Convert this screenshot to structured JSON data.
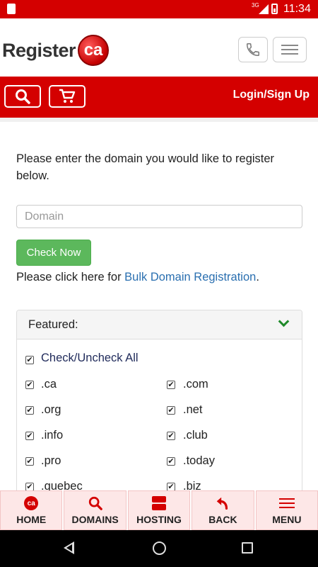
{
  "status_bar": {
    "time": "11:34",
    "network": "3G"
  },
  "header": {
    "logo_text": "Register",
    "logo_badge": "ca",
    "login_label": "Login/Sign Up"
  },
  "main": {
    "intro_text": "Please enter the domain you would like to register below.",
    "domain_placeholder": "Domain",
    "check_button": "Check Now",
    "bulk_prefix": "Please click here for ",
    "bulk_link": "Bulk Domain Registration",
    "bulk_suffix": "."
  },
  "featured": {
    "title": "Featured:",
    "check_all_label": "Check/Uncheck All",
    "tlds_left": [
      ".ca",
      ".org",
      ".info",
      ".pro",
      ".quebec"
    ],
    "tlds_right": [
      ".com",
      ".net",
      ".club",
      ".today",
      ".biz"
    ]
  },
  "bottom_nav": {
    "home": "HOME",
    "home_icon_text": "ca",
    "domains": "DOMAINS",
    "hosting": "HOSTING",
    "back": "BACK",
    "menu": "MENU"
  }
}
